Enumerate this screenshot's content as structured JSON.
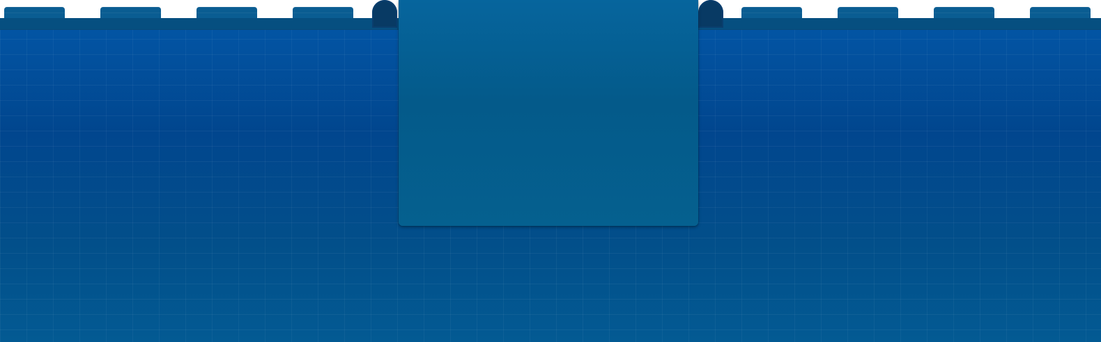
{
  "scene": {
    "description_free": true,
    "colors": {
      "wall_top": "#0256a6",
      "wall_mid": "#01468e",
      "wall_bottom": "#035a93",
      "coping": "#064f80",
      "merlon": "#0a5d92",
      "arch": "#083a64",
      "panel": "#05608f",
      "sky": "#ffffff"
    },
    "merlon_count": 8,
    "arch_count": 2
  }
}
